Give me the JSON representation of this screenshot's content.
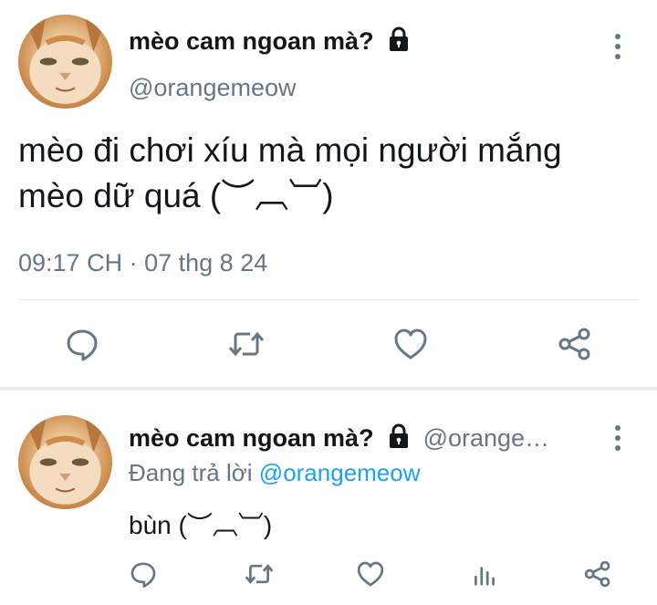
{
  "main_tweet": {
    "display_name": "mèo cam ngoan mà?",
    "handle": "@orangemeow",
    "text_line1": "mèo đi chơi xíu mà mọi người mắng",
    "text_line2": "mèo dữ quá (︶︹︺)",
    "time": "09:17 CH",
    "separator": "·",
    "date": "07 thg 8 24",
    "icons": [
      "avatar",
      "lock-icon",
      "more-icon",
      "reply-icon",
      "retweet-icon",
      "like-icon",
      "share-icon"
    ]
  },
  "reply_tweet": {
    "display_name": "mèo cam ngoan mà?",
    "handle_truncated": "@orange…",
    "replying_prefix": "Đang trả lời",
    "replying_mention": "@orangemeow",
    "text": "bùn (︶︹︺)",
    "icons": [
      "avatar",
      "lock-icon",
      "more-icon",
      "reply-icon",
      "retweet-icon",
      "like-icon",
      "analytics-icon",
      "share-icon"
    ]
  },
  "colors": {
    "text": "#14171a",
    "secondary": "#657786",
    "accent": "#1da1f2",
    "divider": "#e1e8ed"
  }
}
